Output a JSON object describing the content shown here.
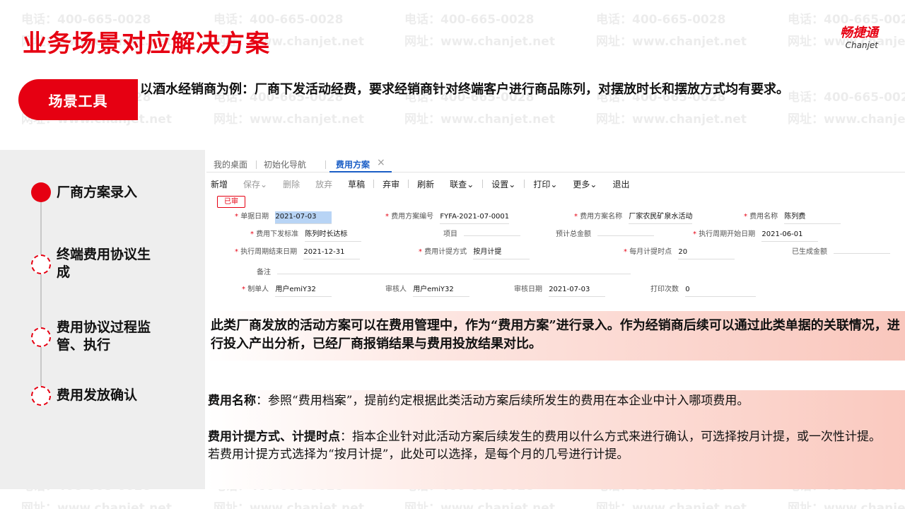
{
  "header": {
    "title": "业务场景对应解决方案",
    "logo_cn": "畅捷通",
    "logo_en": "Chanjet"
  },
  "watermark": {
    "phone": "电话：400-665-0028",
    "site": "网址：www.chanjet.net"
  },
  "scene": {
    "tab_label": "场景工具",
    "description": "以酒水经销商为例：厂商下发活动经费，要求经销商针对终端客户进行商品陈列，对摆放时长和摆放方式均有要求。"
  },
  "steps": [
    {
      "label": "厂商方案录入",
      "active": true
    },
    {
      "label": "终端费用协议生成",
      "active": false
    },
    {
      "label": "费用协议过程监管、执行",
      "active": false
    },
    {
      "label": "费用发放确认",
      "active": false
    }
  ],
  "software": {
    "tabs": [
      "我的桌面",
      "初始化导航",
      "费用方案"
    ],
    "tab_close": "×",
    "toolbar": [
      {
        "label": "新增",
        "disabled": false
      },
      {
        "label": "保存",
        "disabled": true,
        "dropdown": true
      },
      {
        "label": "删除",
        "disabled": true
      },
      {
        "label": "放弃",
        "disabled": true
      },
      {
        "label": "草稿",
        "disabled": false
      },
      {
        "label": "弃审",
        "disabled": false
      },
      {
        "label": "刷新",
        "disabled": false
      },
      {
        "label": "联查",
        "disabled": false,
        "dropdown": true
      },
      {
        "label": "设置",
        "disabled": false,
        "dropdown": true
      },
      {
        "label": "打印",
        "disabled": false,
        "dropdown": true
      },
      {
        "label": "更多",
        "disabled": false,
        "dropdown": true
      },
      {
        "label": "退出",
        "disabled": false
      }
    ],
    "status_stamp": "已审",
    "fields": {
      "bill_date": {
        "label": "单据日期",
        "value": "2021-07-03"
      },
      "plan_code": {
        "label": "费用方案编号",
        "value": "FYFA-2021-07-0001"
      },
      "plan_name": {
        "label": "费用方案名称",
        "value": "厂家农民矿泉水活动"
      },
      "fee_name": {
        "label": "费用名称",
        "value": "陈列费"
      },
      "issue_std": {
        "label": "费用下发标准",
        "value": "陈列时长达标"
      },
      "project": {
        "label": "项目",
        "value": ""
      },
      "budget": {
        "label": "预计总金额",
        "value": ""
      },
      "exec_start": {
        "label": "执行周期开始日期",
        "value": "2021-06-01"
      },
      "exec_end": {
        "label": "执行周期结束日期",
        "value": "2021-12-31"
      },
      "accrual_method": {
        "label": "费用计提方式",
        "value": "按月计提"
      },
      "accrual_day": {
        "label": "每月计提时点",
        "value": "20"
      },
      "generated": {
        "label": "已生成金额",
        "value": ""
      },
      "remark": {
        "label": "备注",
        "value": ""
      },
      "maker": {
        "label": "制单人",
        "value": "用户emiY32"
      },
      "auditor": {
        "label": "审核人",
        "value": "用户emiY32"
      },
      "audit_date": {
        "label": "审核日期",
        "value": "2021-07-03"
      },
      "print_count": {
        "label": "打印次数",
        "value": "0"
      }
    }
  },
  "note_a": "此类厂商发放的活动方案可以在费用管理中，作为“费用方案”进行录入。作为经销商后续可以通过此类单据的关联情况，进行投入产出分析，已经厂商报销结果与费用投放结果对比。",
  "note_b": {
    "p1_bold": "费用名称",
    "p1_text": "：参照“费用档案”，提前约定根据此类活动方案后续所发生的费用在本企业中计入哪项费用。",
    "p2_bold": "费用计提方式、计提时点",
    "p2_text": "：指本企业针对此活动方案后续发生的费用以什么方式来进行确认，可选择按月计提，或一次性计提。",
    "p3_text": "若费用计提方式选择为“按月计提”，此处可以选择，是每个月的几号进行计提。"
  }
}
